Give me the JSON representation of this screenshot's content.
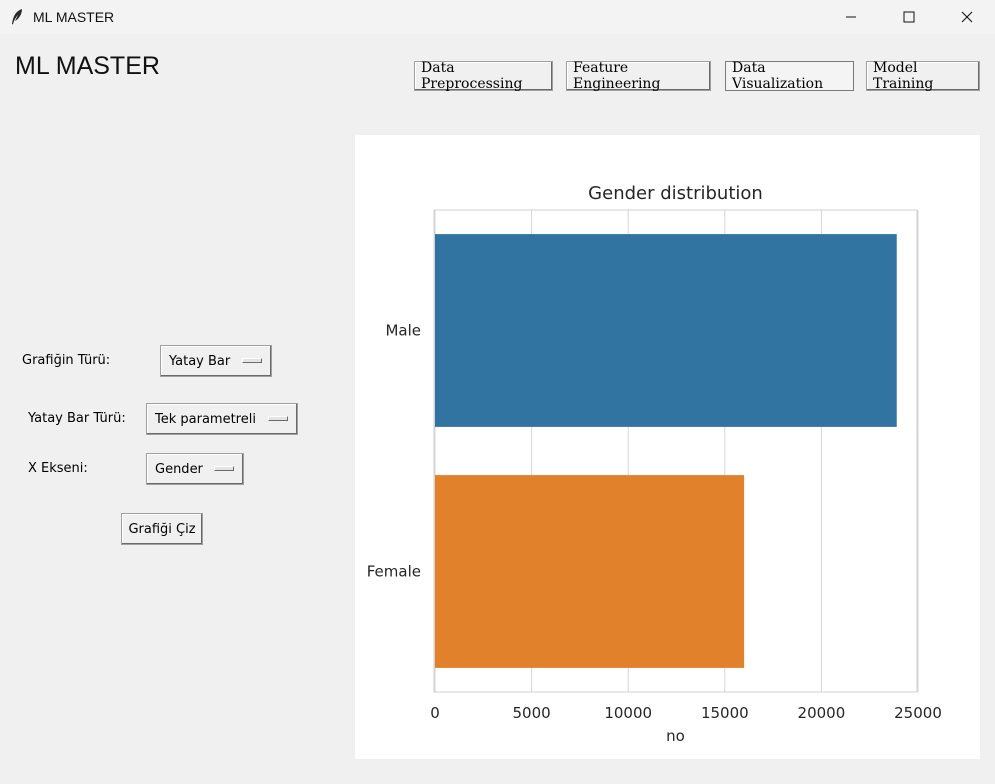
{
  "window": {
    "title": "ML MASTER",
    "app_icon": "feather-icon",
    "controls": [
      "minimize-icon",
      "maximize-icon",
      "close-icon"
    ]
  },
  "header": {
    "title": "ML MASTER",
    "tabs": [
      {
        "label": "Data Preprocessing",
        "active": false
      },
      {
        "label": "Feature Engineering",
        "active": false
      },
      {
        "label": "Data Visualization",
        "active": true
      },
      {
        "label": "Model Training",
        "active": false
      }
    ]
  },
  "form": {
    "chart_type_label": "Grafiğin Türü:",
    "chart_type_value": "Yatay Bar",
    "bar_type_label": "Yatay Bar Türü:",
    "bar_type_value": "Tek parametreli",
    "x_axis_label": "X Ekseni:",
    "x_axis_value": "Gender",
    "plot_button": "Grafiği Çiz"
  },
  "chart_data": {
    "type": "bar",
    "orientation": "horizontal",
    "title": "Gender distribution",
    "xlabel": "no",
    "ylabel": "",
    "categories": [
      "Male",
      "Female"
    ],
    "values": [
      23900,
      16000
    ],
    "colors": [
      "#3274a1",
      "#e1812c"
    ],
    "xlim": [
      0,
      25000
    ],
    "xticks": [
      0,
      5000,
      10000,
      15000,
      20000,
      25000
    ],
    "grid": "vertical"
  }
}
